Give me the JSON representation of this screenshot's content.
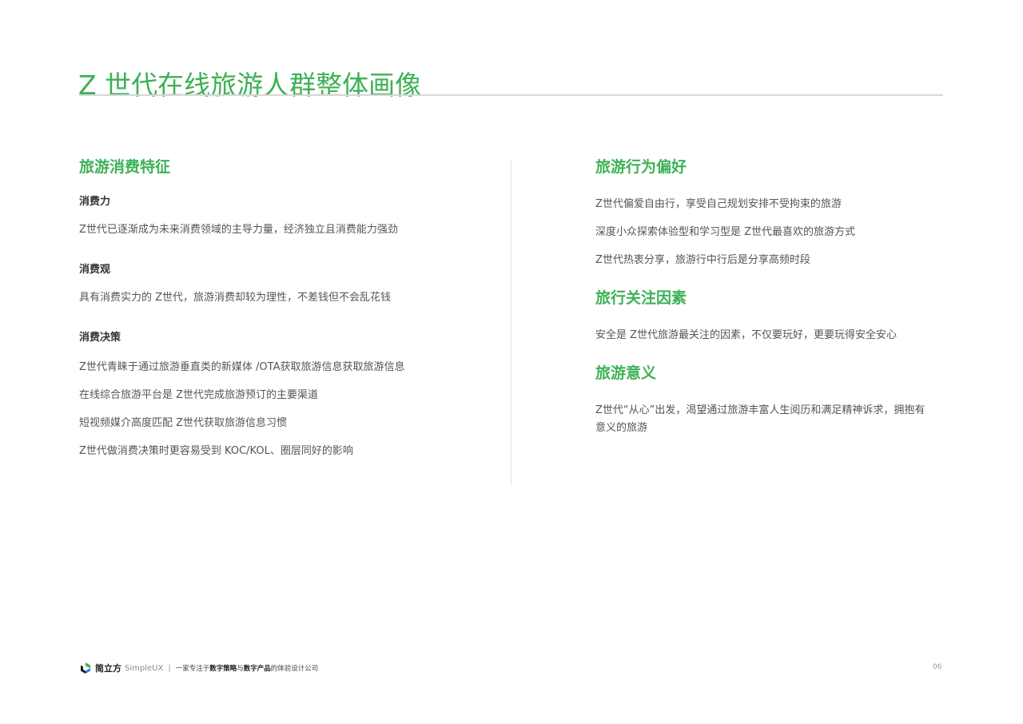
{
  "page": {
    "title": "Z 世代在线旅游人群整体画像",
    "accent_color": "#3db156"
  },
  "left": {
    "section_title": "旅游消费特征",
    "groups": [
      {
        "heading": "消费力",
        "lines": [
          "Z世代已逐渐成为未来消费领域的主导力量，经济独立且消费能力强劲"
        ]
      },
      {
        "heading": "消费观",
        "lines": [
          "具有消费实力的 Z世代，旅游消费却较为理性，不差钱但不会乱花钱"
        ]
      },
      {
        "heading": "消费决策",
        "lines": [
          "Z世代青睐于通过旅游垂直类的新媒体 /OTA获取旅游信息获取旅游信息",
          "在线综合旅游平台是 Z世代完成旅游预订的主要渠道",
          "短视频媒介高度匹配 Z世代获取旅游信息习惯",
          "Z世代做消费决策时更容易受到 KOC/KOL、圈层同好的影响"
        ]
      }
    ]
  },
  "right": {
    "sections": [
      {
        "title": "旅游行为偏好",
        "lines": [
          "Z世代偏爱自由行，享受自己规划安排不受拘束的旅游",
          "深度小众探索体验型和学习型是 Z世代最喜欢的旅游方式",
          "Z世代热衷分享，旅游行中行后是分享高频时段"
        ]
      },
      {
        "title": "旅行关注因素",
        "lines": [
          "安全是 Z世代旅游最关注的因素，不仅要玩好，更要玩得安全安心"
        ]
      },
      {
        "title": "旅游意义",
        "lines": [
          "Z世代“从心”出发，渴望通过旅游丰富人生阅历和满足精神诉求，拥抱有意义的旅游"
        ]
      }
    ]
  },
  "footer": {
    "brand_cn": "简立方",
    "brand_en": "SimpleUX",
    "separator": "|",
    "tagline_pre": "一家专注于",
    "tagline_b1": "数字策略",
    "tagline_mid": "与",
    "tagline_b2": "数字产品",
    "tagline_post": "的体验设计公司",
    "page_number": "06"
  }
}
